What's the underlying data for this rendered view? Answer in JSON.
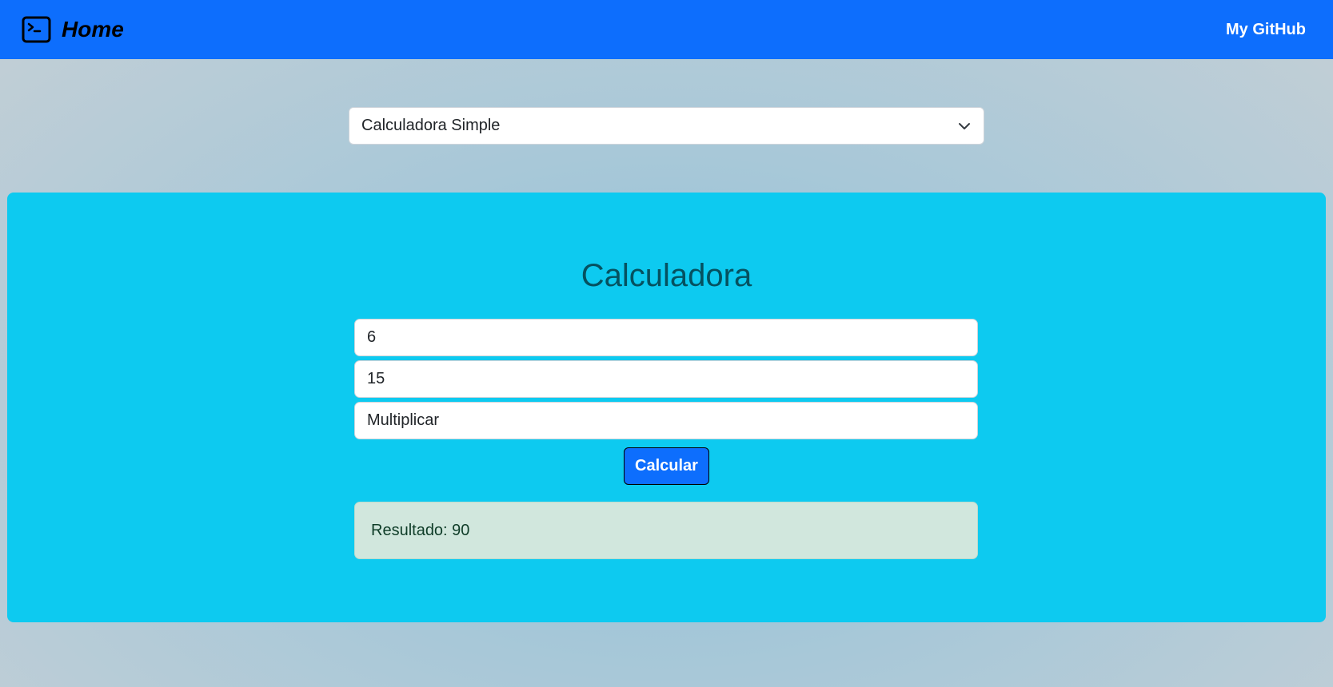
{
  "navbar": {
    "brand_label": "Home",
    "brand_icon": "terminal-icon",
    "github_link": "My GitHub",
    "bg_color": "#0d6efd"
  },
  "selector": {
    "selected": "Calculadora Simple",
    "icon": "chevron-down-icon"
  },
  "calculator": {
    "title": "Calculadora",
    "input_a": "6",
    "input_b": "15",
    "operation": "Multiplicar",
    "button_label": "Calcular",
    "result_text": "Resultado: 90",
    "card_color": "#0dcaf0",
    "result_bg": "#d1e7dd"
  }
}
